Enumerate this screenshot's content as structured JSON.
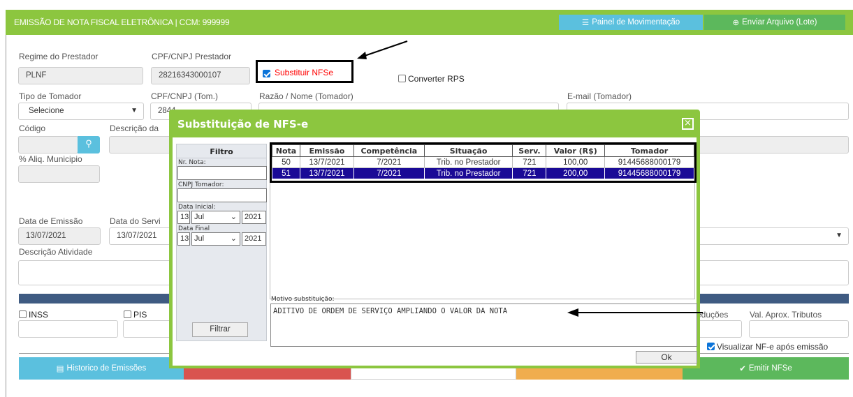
{
  "header": {
    "title": "EMISSÃO DE NOTA FISCAL ELETRÔNICA | CCM: 999999",
    "painel_label": "Painel de Movimentação",
    "enviar_label": "Enviar Arquivo (Lote)"
  },
  "form": {
    "regime_label": "Regime do Prestador",
    "regime_value": "PLNF",
    "cpf_prestador_label": "CPF/CNPJ Prestador",
    "cpf_prestador_value": "28216343000107",
    "substituir_label": "Substituir NFSe",
    "converter_label": "Converter RPS",
    "tipo_tomador_label": "Tipo de Tomador",
    "tipo_tomador_value": "Selecione",
    "cpf_tomador_label": "CPF/CNPJ (Tom.)",
    "cpf_tomador_value": "2844",
    "razao_label": "Razão / Nome (Tomador)",
    "email_label": "E-mail (Tomador)",
    "codigo_label": "Código",
    "descricao_label": "Descrição da",
    "aliq_label": "% Aliq. Municipio",
    "data_emissao_label": "Data de Emissão",
    "data_emissao_value": "13/07/2021",
    "data_servico_label": "Data do Servi",
    "data_servico_value": "13/07/2021",
    "descricao_atividade_label": "Descrição Atividade",
    "inss_label": "INSS",
    "pis_label": "PIS",
    "deducoes_label": "eduções",
    "val_aprox_label": "Val. Aprox. Tributos",
    "visualizar_label": "Visualizar NF-e após emissão"
  },
  "bottom_buttons": {
    "historico": "Historico de Emissões",
    "emitir": "Emitir NFSe"
  },
  "modal": {
    "title": "Substituição de NFS-e",
    "filter_title": "Filtro",
    "nr_nota_label": "Nr. Nota:",
    "cnpj_tomador_label": "CNPJ Tomador:",
    "data_inicial_label": "Data Inicial:",
    "data_final_label": "Data Final",
    "di_day": "13",
    "di_month": "Jul",
    "di_year": "2021",
    "df_day": "13",
    "df_month": "Jul",
    "df_year": "2021",
    "filtrar_label": "Filtrar",
    "columns": [
      "Nota",
      "Emissão",
      "Competência",
      "Situação",
      "Serv.",
      "Valor (R$)",
      "Tomador"
    ],
    "rows": [
      [
        "50",
        "13/7/2021",
        "7/2021",
        "Trib. no Prestador",
        "721",
        "100,00",
        "91445688000179"
      ],
      [
        "51",
        "13/7/2021",
        "7/2021",
        "Trib. no Prestador",
        "721",
        "200,00",
        "91445688000179"
      ]
    ],
    "motivo_label": "Motivo substituição:",
    "motivo_value": "ADITIVO DE ORDEM DE SERVIÇO AMPLIANDO O VALOR DA NOTA",
    "ok_label": "Ok"
  },
  "colors": {
    "green": "#8cc63f",
    "selected_row": "#1a0a96",
    "info_button": "#5bc0de",
    "success_button": "#5cb85c",
    "danger_button": "#d9534f",
    "warning_button": "#f0ad4e",
    "header_bar": "#3f5b82"
  }
}
